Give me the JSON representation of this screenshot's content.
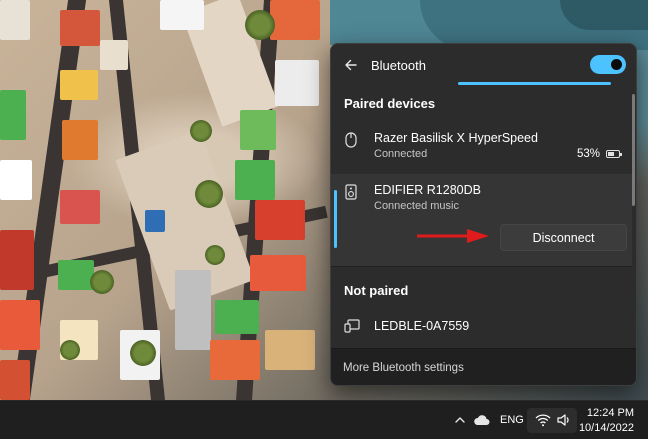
{
  "flyout": {
    "title": "Bluetooth",
    "back_icon": "arrow-left-icon",
    "toggle_on": true,
    "accent_color": "#4cc2ff"
  },
  "paired_section": {
    "label": "Paired devices"
  },
  "paired_devices": [
    {
      "name": "Razer Basilisk X HyperSpeed",
      "status": "Connected",
      "battery": "53%",
      "icon": "mouse-icon"
    },
    {
      "name": "EDIFIER R1280DB",
      "status": "Connected music",
      "icon": "speaker-icon",
      "action": "Disconnect"
    }
  ],
  "not_paired_section": {
    "label": "Not paired"
  },
  "unpaired_devices": [
    {
      "name": "LEDBLE-0A7559",
      "icon": "generic-device-icon"
    }
  ],
  "footer": {
    "link": "More Bluetooth settings"
  },
  "annotation": {
    "arrow_color": "#e01b1b"
  },
  "taskbar": {
    "language": "ENG",
    "time": "12:24 PM",
    "date": "10/14/2022"
  }
}
